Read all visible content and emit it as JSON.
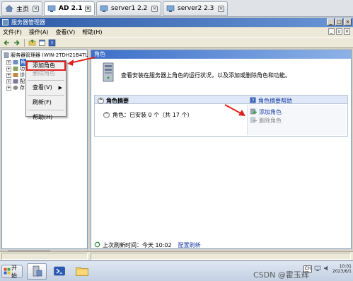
{
  "vm_tabs": [
    {
      "label": "主页",
      "active": false
    },
    {
      "label": "AD 2.1",
      "active": true
    },
    {
      "label": "server1 2.2",
      "active": false
    },
    {
      "label": "server2 2.3",
      "active": false
    }
  ],
  "window": {
    "title": "服务器管理器"
  },
  "menu": {
    "items": [
      "文件(F)",
      "操作(A)",
      "查看(V)",
      "帮助(H)"
    ]
  },
  "tree": {
    "root": "服务器管理器 (WIN-2TDH21B4TL",
    "selected_label": "角",
    "items": [
      "功",
      "诊",
      "配",
      "存"
    ]
  },
  "context_menu": {
    "items": [
      {
        "label": "添加角色",
        "highlighted": true
      },
      {
        "label": "删除角色",
        "disabled": true
      },
      {
        "label": "查看(V)",
        "submenu": true
      },
      {
        "label": "刷新(F)"
      },
      {
        "label": "帮助(H)"
      }
    ]
  },
  "right_pane": {
    "header": "角色",
    "description": "查看安装在服务器上角色的运行状况，以及添加或删除角色和功能。",
    "summary_title": "角色摘要",
    "summary_help": "角色摘要帮助",
    "roles_status": "角色：已安装 0 个（共 17 个）",
    "add_roles": "添加角色",
    "remove_roles": "删除角色",
    "last_refresh": "上次刷新时间：今天 10:02",
    "configure_refresh": "配置刷新"
  },
  "taskbar": {
    "start": "开始",
    "tray_lang": "CH",
    "time": "10:01",
    "date": "2023/6/1"
  },
  "watermark": "CSDN @霍玉辉",
  "colors": {
    "highlight_red": "#e02020",
    "link_blue": "#1a3fa6",
    "title_blue": "#2c5aa5"
  }
}
